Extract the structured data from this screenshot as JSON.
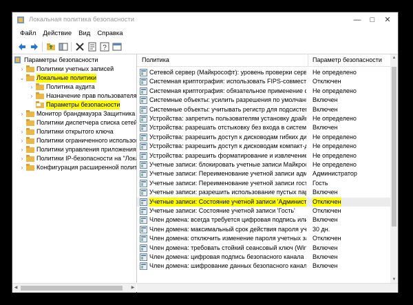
{
  "window": {
    "title": "Локальная политика безопасности"
  },
  "menu": [
    "Файл",
    "Действие",
    "Вид",
    "Справка"
  ],
  "tree": [
    {
      "label": "Параметры безопасности",
      "level": 0,
      "chevron": "",
      "highlight": false,
      "root": true
    },
    {
      "label": "Политики учетных записей",
      "level": 1,
      "chevron": "›",
      "highlight": false
    },
    {
      "label": "Локальные политики",
      "level": 1,
      "chevron": "⌄",
      "highlight": true
    },
    {
      "label": "Политика аудита",
      "level": 2,
      "chevron": "›",
      "highlight": false
    },
    {
      "label": "Назначение прав пользователя",
      "level": 2,
      "chevron": "›",
      "highlight": false
    },
    {
      "label": "Параметры безопасности",
      "level": 2,
      "chevron": "",
      "highlight": true,
      "open": true
    },
    {
      "label": "Монитор брандмауэра Защитника",
      "level": 1,
      "chevron": "›",
      "highlight": false
    },
    {
      "label": "Политики диспетчера списка сетей",
      "level": 1,
      "chevron": "",
      "highlight": false
    },
    {
      "label": "Политики открытого ключа",
      "level": 1,
      "chevron": "›",
      "highlight": false
    },
    {
      "label": "Политики ограниченного использования",
      "level": 1,
      "chevron": "›",
      "highlight": false
    },
    {
      "label": "Политики управления приложениями",
      "level": 1,
      "chevron": "›",
      "highlight": false
    },
    {
      "label": "Политики IP-безопасности на \"Лока",
      "level": 1,
      "chevron": "›",
      "highlight": false
    },
    {
      "label": "Конфигурация расширенной политик",
      "level": 1,
      "chevron": "›",
      "highlight": false
    }
  ],
  "columns": {
    "policy": "Политика",
    "setting": "Параметр безопасности"
  },
  "rows": [
    {
      "name": "Сетевой сервер (Майкрософт): уровень проверки сервер...",
      "value": "Не определено"
    },
    {
      "name": "Системная криптография: использовать FIPS-совместим...",
      "value": "Отключен"
    },
    {
      "name": "Системная криптография: обязательное применение сил...",
      "value": "Не определено"
    },
    {
      "name": "Системные объекты: усилить разрешения по умолчани...",
      "value": "Включен"
    },
    {
      "name": "Системные объекты: учитывать регистр для подсистем, ...",
      "value": "Включен"
    },
    {
      "name": "Устройства: запретить пользователям установку драйвер...",
      "value": "Не определено"
    },
    {
      "name": "Устройства: разрешать отстыковку без входа в систему",
      "value": "Включен"
    },
    {
      "name": "Устройства: разрешить доступ к дисководам гибких диск...",
      "value": "Не определено"
    },
    {
      "name": "Устройства: разрешить доступ к дисководам компакт-ди...",
      "value": "Не определено"
    },
    {
      "name": "Устройства: разрешить форматирование и извлечение съ...",
      "value": "Не определено"
    },
    {
      "name": "Учетные записи: блокировать учетные записи Майкросо...",
      "value": "Не определено"
    },
    {
      "name": "Учетные записи: Переименование учетной записи адми...",
      "value": "Администратор"
    },
    {
      "name": "Учетные записи: Переименование учетной записи гостя",
      "value": "Гость"
    },
    {
      "name": "Учетные записи: разрешить использование пустых паро...",
      "value": "Включен"
    },
    {
      "name": "Учетные записи: Состояние учетной записи 'Администра...",
      "value": "Отключен",
      "highlight": true
    },
    {
      "name": "Учетные записи: Состояние учетной записи 'Гость'",
      "value": "Отключен"
    },
    {
      "name": "Член домена: всегда требуется цифровая подпись или ш...",
      "value": "Включен"
    },
    {
      "name": "Член домена: максимальный срок действия пароля учет...",
      "value": "30 дн."
    },
    {
      "name": "Член домена: отключить изменение пароля учетных за...",
      "value": "Отключен"
    },
    {
      "name": "Член домена: требовать стойкий сеансовый ключ (Wind...",
      "value": "Включен"
    },
    {
      "name": "Член домена: цифровая подпись безопасного канала ...",
      "value": "Включен"
    },
    {
      "name": "Член домена: шифрование данных безопасного канала, ...",
      "value": "Включен"
    }
  ],
  "colors": {
    "highlight": "#ffff00",
    "folder": "#e8b94a",
    "policyIcon": "#6a8aa8"
  },
  "icons": [
    "back-arrow-icon",
    "forward-arrow-icon",
    "up-folder-icon",
    "show-hide-tree-icon",
    "delete-icon",
    "properties-icon",
    "help-icon",
    "console-icon"
  ]
}
